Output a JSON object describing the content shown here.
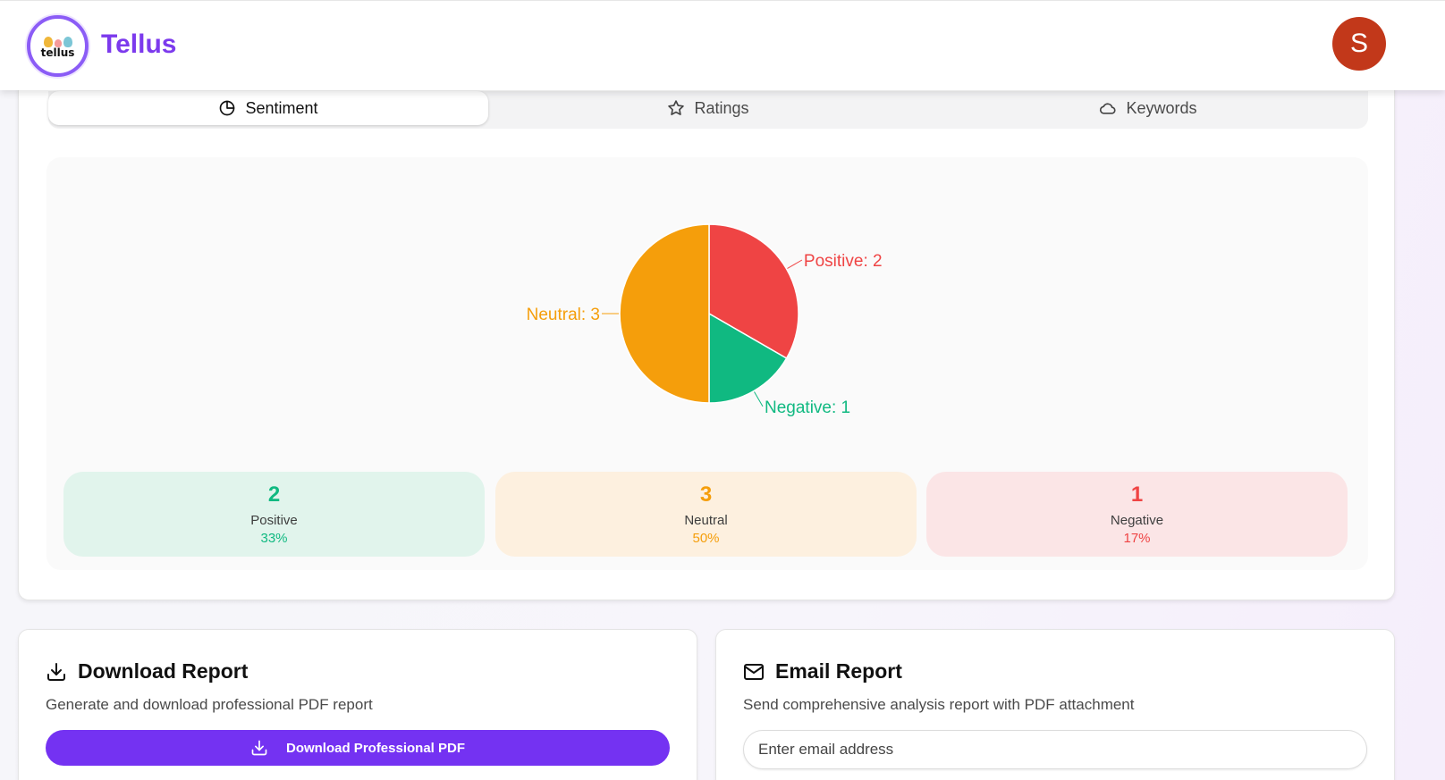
{
  "header": {
    "brand": "Tellus",
    "logo_word": "tellus",
    "avatar_initial": "S"
  },
  "tabs": [
    {
      "label": "Sentiment",
      "icon": "pie-chart-icon",
      "active": true
    },
    {
      "label": "Ratings",
      "icon": "star-icon",
      "active": false
    },
    {
      "label": "Keywords",
      "icon": "cloud-icon",
      "active": false
    }
  ],
  "chart_data": {
    "type": "pie",
    "slices": [
      {
        "name": "Positive",
        "value": 2,
        "label": "Positive: 2",
        "color": "#ef4444"
      },
      {
        "name": "Negative",
        "value": 1,
        "label": "Negative: 1",
        "color": "#10b981"
      },
      {
        "name": "Neutral",
        "value": 3,
        "label": "Neutral: 3",
        "color": "#f59e0b"
      }
    ]
  },
  "stats": [
    {
      "value": "2",
      "label": "Positive",
      "percent": "33%",
      "color": "#10b981",
      "bg": "#e1f4ec"
    },
    {
      "value": "3",
      "label": "Neutral",
      "percent": "50%",
      "color": "#f59e0b",
      "bg": "#fdf0df"
    },
    {
      "value": "1",
      "label": "Negative",
      "percent": "17%",
      "color": "#ef4444",
      "bg": "#fbe5e6"
    }
  ],
  "download_card": {
    "title": "Download Report",
    "subtitle": "Generate and download professional PDF report",
    "button_label": "Download Professional PDF"
  },
  "email_card": {
    "title": "Email Report",
    "subtitle": "Send comprehensive analysis report with PDF attachment",
    "input_placeholder": "Enter email address"
  },
  "colors": {
    "accent": "#7432f2",
    "brand": "#7c3aed",
    "avatar": "#c2381a"
  }
}
